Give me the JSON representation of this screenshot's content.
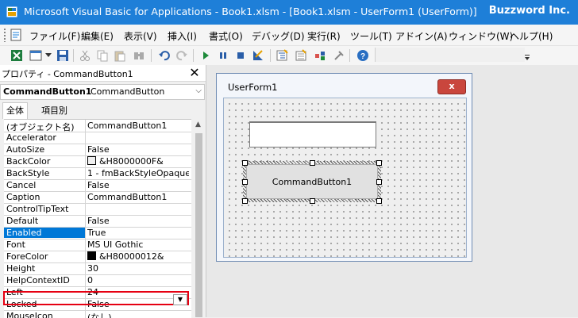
{
  "window": {
    "title": "Microsoft Visual Basic for Applications - Book1.xlsm - [Book1.xlsm - UserForm1 (UserForm)]",
    "brand": "Buzzword Inc."
  },
  "menu": [
    {
      "label": "ファイル(F)"
    },
    {
      "label": "編集(E)"
    },
    {
      "label": "表示(V)"
    },
    {
      "label": "挿入(I)"
    },
    {
      "label": "書式(O)"
    },
    {
      "label": "デバッグ(D)"
    },
    {
      "label": "実行(R)"
    },
    {
      "label": "ツール(T)"
    },
    {
      "label": "アドイン(A)"
    },
    {
      "label": "ウィンドウ(W)"
    },
    {
      "label": "ヘルプ(H)"
    }
  ],
  "toolbar": {
    "icons": [
      "excel-icon",
      "insert-userform-icon",
      "save-icon",
      "cut-icon",
      "copy-icon",
      "paste-icon",
      "find-icon",
      "undo-icon",
      "redo-icon",
      "run-icon",
      "break-icon",
      "reset-icon",
      "design-mode-icon",
      "project-explorer-icon",
      "properties-window-icon",
      "object-browser-icon",
      "toolbox-icon",
      "help-icon"
    ]
  },
  "properties": {
    "title": "プロパティ - CommandButton1",
    "object_name": "CommandButton1",
    "object_type": "CommandButton",
    "tabs": [
      "全体",
      "項目別"
    ],
    "rows": [
      {
        "name": "(オブジェクト名)",
        "value": "CommandButton1"
      },
      {
        "name": "Accelerator",
        "value": ""
      },
      {
        "name": "AutoSize",
        "value": "False"
      },
      {
        "name": "BackColor",
        "value": "&H8000000F&",
        "swatch": "#f0f0f0"
      },
      {
        "name": "BackStyle",
        "value": "1 - fmBackStyleOpaque"
      },
      {
        "name": "Cancel",
        "value": "False"
      },
      {
        "name": "Caption",
        "value": "CommandButton1"
      },
      {
        "name": "ControlTipText",
        "value": ""
      },
      {
        "name": "Default",
        "value": "False"
      },
      {
        "name": "Enabled",
        "value": "True",
        "selected": true
      },
      {
        "name": "Font",
        "value": "MS UI Gothic"
      },
      {
        "name": "ForeColor",
        "value": "&H80000012&",
        "swatch": "#000000"
      },
      {
        "name": "Height",
        "value": "30"
      },
      {
        "name": "HelpContextID",
        "value": "0"
      },
      {
        "name": "Left",
        "value": "24"
      },
      {
        "name": "Locked",
        "value": "False"
      },
      {
        "name": "MouseIcon",
        "value": "(なし)"
      }
    ]
  },
  "userform": {
    "title": "UserForm1",
    "close_label": "x",
    "button_caption": "CommandButton1"
  },
  "colors": {
    "titlebar": "#1e7fd8",
    "selection": "#0078d7",
    "highlight_border": "#e60012",
    "close_button": "#c9463d"
  }
}
